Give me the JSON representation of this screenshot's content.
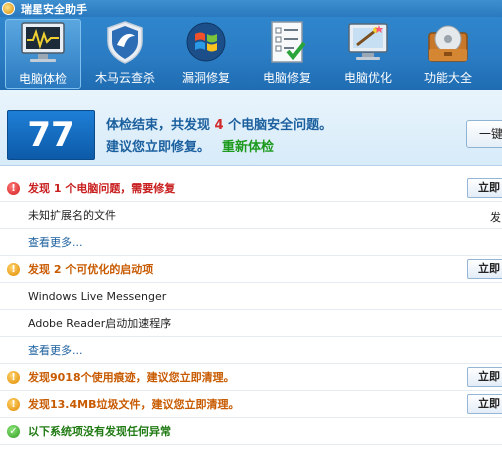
{
  "window": {
    "title": "瑞星安全助手"
  },
  "toolbar": {
    "items": [
      {
        "label": "电脑体检",
        "icon": "monitor-pulse-icon",
        "active": true
      },
      {
        "label": "木马云查杀",
        "icon": "shield-icon",
        "active": false
      },
      {
        "label": "漏洞修复",
        "icon": "windows-flag-icon",
        "active": false
      },
      {
        "label": "电脑修复",
        "icon": "checklist-icon",
        "active": false
      },
      {
        "label": "电脑优化",
        "icon": "magic-wand-monitor-icon",
        "active": false
      },
      {
        "label": "功能大全",
        "icon": "toolbox-icon",
        "active": false
      }
    ]
  },
  "banner": {
    "score": "77",
    "line1_prefix": "体检结束，共发现 ",
    "line1_count": "4",
    "line1_suffix": " 个电脑安全问题。",
    "line2": "建议您立即修复。",
    "recheck": "重新体检",
    "button": "一键"
  },
  "list": {
    "section1": {
      "title": "发现 1 个电脑问题，需要修复",
      "button": "立即"
    },
    "item1": {
      "text": "未知扩展名的文件",
      "right": "发"
    },
    "more1": "查看更多...",
    "section2": {
      "title": "发现 2 个可优化的启动项",
      "button": "立即"
    },
    "item2": {
      "text": "Windows Live Messenger"
    },
    "item3": {
      "text": "Adobe Reader启动加速程序"
    },
    "more2": "查看更多...",
    "section3": {
      "title": "发现9018个使用痕迹，建议您立即清理。",
      "button": "立即"
    },
    "section4": {
      "title": "发现13.4MB垃圾文件，建议您立即清理。",
      "button": "立即"
    },
    "section5": {
      "title": "以下系统项没有发现任何异常"
    }
  },
  "colors": {
    "accent": "#2a7cc3",
    "danger": "#c81e1e",
    "warning": "#c85a00",
    "ok": "#1f7a12"
  }
}
